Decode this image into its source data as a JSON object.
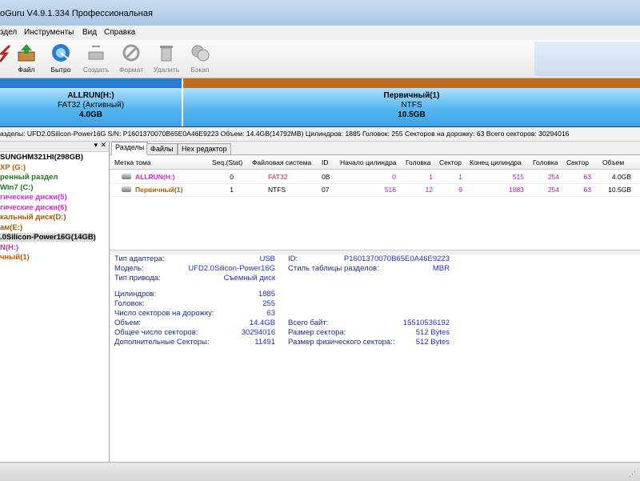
{
  "window": {
    "title": "oGuru V4.9.1.334 Профессиональная"
  },
  "menu": {
    "items": [
      "здел",
      "Инструменты",
      "Вид",
      "Справка"
    ]
  },
  "toolbar": {
    "buttons": [
      {
        "label": "Файл",
        "icon": "backup-partition-icon"
      },
      {
        "label": "Бытро",
        "icon": "quick-partition-icon"
      },
      {
        "label": "Создать",
        "icon": "create-partition-icon"
      },
      {
        "label": "Формат",
        "icon": "format-icon"
      },
      {
        "label": "Удалить",
        "icon": "delete-icon"
      },
      {
        "label": "Бэкап",
        "icon": "backup-icon"
      }
    ]
  },
  "disk_map": {
    "partitions": [
      {
        "name": "ALLRUN(H:)",
        "fs": "FAT32 (Активный)",
        "size": "4.0GB",
        "accent": "#3aa4e8",
        "bar": "#2b7bd1"
      },
      {
        "name": "Первичный(1)",
        "fs": "NTFS",
        "size": "10.5GB",
        "accent": "#3aa4e8",
        "bar": "#c0701d"
      }
    ]
  },
  "info_line": "азделы:  UFD2.0Silicon-Power16G  S/N: P1601370070B65E0A46E9223  Объем: 14.4GB(14792MB)  Цилиндров: 1885  Головок: 255  Секторов на дорожку: 63  Всего секторов: 30294016",
  "tree": {
    "items": [
      {
        "label": "SUNGHM321HI(298GB)",
        "color": "#000000"
      },
      {
        "label": "XP (G:)",
        "color": "#c25a00"
      },
      {
        "label": "ренный раздел",
        "color": "#1a7a1a"
      },
      {
        "label": "Win7 (C:)",
        "color": "#1a7a1a"
      },
      {
        "label": "гические диски(5)",
        "color": "#d02cd0"
      },
      {
        "label": "гические диски(6)",
        "color": "#d02cd0"
      },
      {
        "label": "кальный диск(D:)",
        "color": "#9c5a00"
      },
      {
        "label": "ам(E:)",
        "color": "#9c5a00"
      },
      {
        "label": ".0Silicon-Power16G(14GB)",
        "color": "#000000"
      },
      {
        "label": "N(H:)",
        "color": "#c02cc0"
      },
      {
        "label": "чный(1)",
        "color": "#c25a00"
      }
    ]
  },
  "tabs": [
    "Разделы",
    "Файлы",
    "Hex редактор"
  ],
  "partition_table": {
    "columns": [
      "Метка тома",
      "Seq.(Stat)",
      "Файловая система",
      "ID",
      "Начало цилиндра",
      "Головка",
      "Сектор",
      "Конец цилиндра",
      "Головка",
      "Сектор",
      "Объем"
    ],
    "rows": [
      {
        "label": "ALLRUN(H:)",
        "label_color": "#c02cc0",
        "seq": "0",
        "fs": "FAT32",
        "fs_color": "#d02020",
        "id": "0B",
        "start_cyl": "0",
        "head": "1",
        "sector": "1",
        "end_cyl": "515",
        "end_head": "254",
        "end_sector": "63",
        "size": "4.0GB"
      },
      {
        "label": "Первичный(1)",
        "label_color": "#b05a00",
        "seq": "1",
        "fs": "NTFS",
        "fs_color": "#000000",
        "id": "07",
        "start_cyl": "516",
        "head": "12",
        "sector": "9",
        "end_cyl": "1883",
        "end_head": "254",
        "end_sector": "63",
        "size": "10.5GB"
      }
    ]
  },
  "details": {
    "adapter_type_label": "Тип адаптера:",
    "adapter_type": "USB",
    "model_label": "Модель:",
    "model": "UFD2.0Silicon-Power16G",
    "drive_type_label": "Тип привода:",
    "drive_type": "Съемный диск",
    "id_label": "ID:",
    "id": "P1601370070B65E0A46E9223",
    "table_style_label": "Стиль таблицы разделов:",
    "table_style": "MBR",
    "cylinders_label": "Цилиндров:",
    "cylinders": "1885",
    "heads_label": "Головок:",
    "heads": "255",
    "spt_label": "Число секторов на дорожку:",
    "spt": "63",
    "capacity_label": "Объем:",
    "capacity": "14.4GB",
    "total_bytes_label": "Всего байт:",
    "total_bytes": "15510536192",
    "total_sectors_label": "Общее число секторов:",
    "total_sectors": "30294016",
    "sector_size_label": "Размер сектора:",
    "sector_size": "512 Bytes",
    "extra_sectors_label": "Дополнительные Секторы:",
    "extra_sectors": "11491",
    "phys_sector_label": "Размер физического сектора::",
    "phys_sector": "512 Bytes"
  }
}
